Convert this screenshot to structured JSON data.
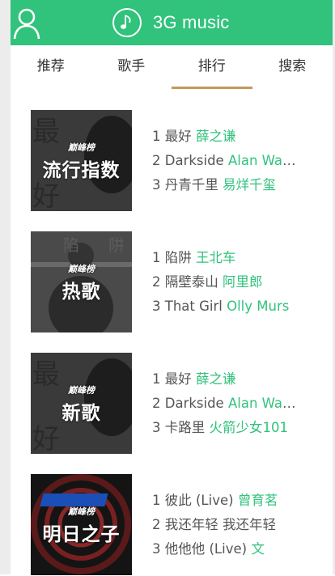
{
  "header": {
    "title": "3G music",
    "user_icon": "user-icon",
    "logo_icon": "music-note-icon",
    "accent_color": "#31c27c"
  },
  "tabs": [
    {
      "label": "推荐",
      "active": false
    },
    {
      "label": "歌手",
      "active": false
    },
    {
      "label": "排行",
      "active": true
    },
    {
      "label": "搜索",
      "active": false
    }
  ],
  "charts": [
    {
      "cover_label": "流行指数",
      "cover_badge": "巅峰榜",
      "songs": [
        {
          "rank": "1",
          "name": "最好",
          "artist": "薛之谦"
        },
        {
          "rank": "2",
          "name": "Darkside",
          "artist": "Alan Walker"
        },
        {
          "rank": "3",
          "name": "丹青千里",
          "artist": "易烊千玺"
        }
      ]
    },
    {
      "cover_label": "热歌",
      "cover_badge": "巅峰榜",
      "songs": [
        {
          "rank": "1",
          "name": "陷阱",
          "artist": "王北车"
        },
        {
          "rank": "2",
          "name": "隔壁泰山",
          "artist": "阿里郎"
        },
        {
          "rank": "3",
          "name": "That Girl",
          "artist": "Olly Murs"
        }
      ]
    },
    {
      "cover_label": "新歌",
      "cover_badge": "巅峰榜",
      "songs": [
        {
          "rank": "1",
          "name": "最好",
          "artist": "薛之谦"
        },
        {
          "rank": "2",
          "name": "Darkside",
          "artist": "Alan Walker"
        },
        {
          "rank": "3",
          "name": "卡路里",
          "artist": "火箭少女101"
        }
      ]
    },
    {
      "cover_label": "明日之子",
      "cover_badge": "巅峰榜",
      "songs": [
        {
          "rank": "1",
          "name": "彼此 (Live)",
          "artist": "曾育茗"
        },
        {
          "rank": "2",
          "name": "我还年轻 我还年轻",
          "artist": ""
        },
        {
          "rank": "3",
          "name": "他他他 (Live)",
          "artist": "文"
        }
      ]
    }
  ]
}
